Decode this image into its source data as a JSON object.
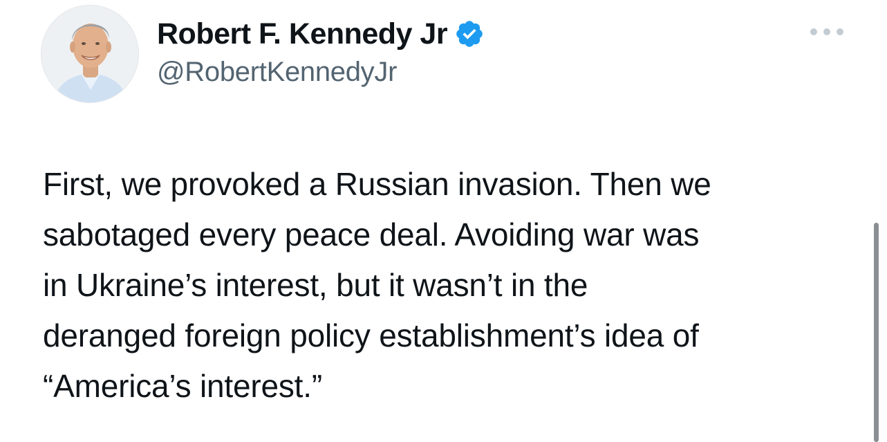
{
  "tweet": {
    "author": {
      "display_name": "Robert F. Kennedy Jr",
      "handle": "@RobertKennedyJr",
      "verified": true,
      "verified_icon": "verified-badge-icon",
      "avatar_icon": "profile-photo"
    },
    "more_icon": "more-options-icon",
    "text_lines": [
      "First, we provoked a Russian invasion. Then we",
      "sabotaged every peace deal. Avoiding war was",
      "in Ukraine’s interest, but it wasn’t in the",
      "deranged foreign policy establishment’s idea of",
      "“America’s interest.”"
    ]
  },
  "colors": {
    "verified_blue": "#1d9bf0",
    "text_primary": "#0f1419",
    "text_secondary": "#536471",
    "more_dots": "#c3cbd3",
    "scrollbar": "#8a8f94"
  }
}
